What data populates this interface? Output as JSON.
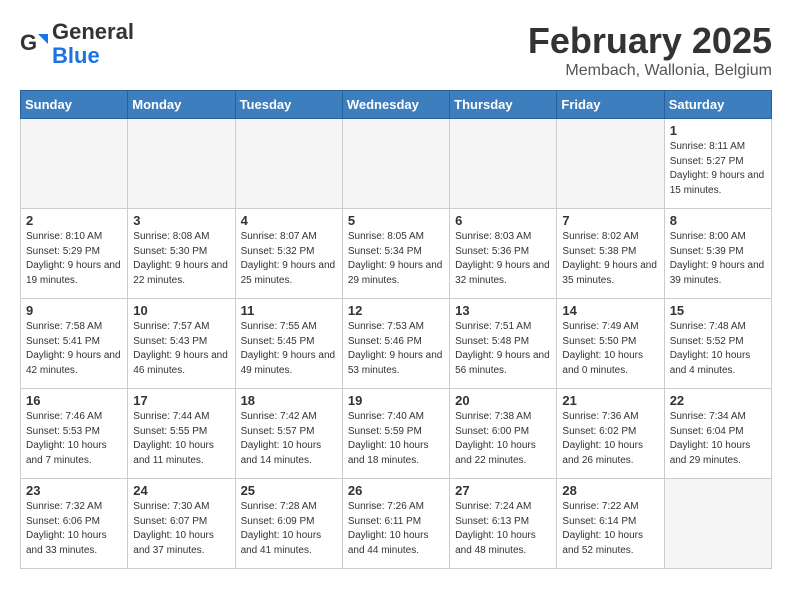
{
  "header": {
    "logo_general": "General",
    "logo_blue": "Blue",
    "month": "February 2025",
    "location": "Membach, Wallonia, Belgium"
  },
  "days_of_week": [
    "Sunday",
    "Monday",
    "Tuesday",
    "Wednesday",
    "Thursday",
    "Friday",
    "Saturday"
  ],
  "weeks": [
    [
      {
        "day": "",
        "info": ""
      },
      {
        "day": "",
        "info": ""
      },
      {
        "day": "",
        "info": ""
      },
      {
        "day": "",
        "info": ""
      },
      {
        "day": "",
        "info": ""
      },
      {
        "day": "",
        "info": ""
      },
      {
        "day": "1",
        "info": "Sunrise: 8:11 AM\nSunset: 5:27 PM\nDaylight: 9 hours and 15 minutes."
      }
    ],
    [
      {
        "day": "2",
        "info": "Sunrise: 8:10 AM\nSunset: 5:29 PM\nDaylight: 9 hours and 19 minutes."
      },
      {
        "day": "3",
        "info": "Sunrise: 8:08 AM\nSunset: 5:30 PM\nDaylight: 9 hours and 22 minutes."
      },
      {
        "day": "4",
        "info": "Sunrise: 8:07 AM\nSunset: 5:32 PM\nDaylight: 9 hours and 25 minutes."
      },
      {
        "day": "5",
        "info": "Sunrise: 8:05 AM\nSunset: 5:34 PM\nDaylight: 9 hours and 29 minutes."
      },
      {
        "day": "6",
        "info": "Sunrise: 8:03 AM\nSunset: 5:36 PM\nDaylight: 9 hours and 32 minutes."
      },
      {
        "day": "7",
        "info": "Sunrise: 8:02 AM\nSunset: 5:38 PM\nDaylight: 9 hours and 35 minutes."
      },
      {
        "day": "8",
        "info": "Sunrise: 8:00 AM\nSunset: 5:39 PM\nDaylight: 9 hours and 39 minutes."
      }
    ],
    [
      {
        "day": "9",
        "info": "Sunrise: 7:58 AM\nSunset: 5:41 PM\nDaylight: 9 hours and 42 minutes."
      },
      {
        "day": "10",
        "info": "Sunrise: 7:57 AM\nSunset: 5:43 PM\nDaylight: 9 hours and 46 minutes."
      },
      {
        "day": "11",
        "info": "Sunrise: 7:55 AM\nSunset: 5:45 PM\nDaylight: 9 hours and 49 minutes."
      },
      {
        "day": "12",
        "info": "Sunrise: 7:53 AM\nSunset: 5:46 PM\nDaylight: 9 hours and 53 minutes."
      },
      {
        "day": "13",
        "info": "Sunrise: 7:51 AM\nSunset: 5:48 PM\nDaylight: 9 hours and 56 minutes."
      },
      {
        "day": "14",
        "info": "Sunrise: 7:49 AM\nSunset: 5:50 PM\nDaylight: 10 hours and 0 minutes."
      },
      {
        "day": "15",
        "info": "Sunrise: 7:48 AM\nSunset: 5:52 PM\nDaylight: 10 hours and 4 minutes."
      }
    ],
    [
      {
        "day": "16",
        "info": "Sunrise: 7:46 AM\nSunset: 5:53 PM\nDaylight: 10 hours and 7 minutes."
      },
      {
        "day": "17",
        "info": "Sunrise: 7:44 AM\nSunset: 5:55 PM\nDaylight: 10 hours and 11 minutes."
      },
      {
        "day": "18",
        "info": "Sunrise: 7:42 AM\nSunset: 5:57 PM\nDaylight: 10 hours and 14 minutes."
      },
      {
        "day": "19",
        "info": "Sunrise: 7:40 AM\nSunset: 5:59 PM\nDaylight: 10 hours and 18 minutes."
      },
      {
        "day": "20",
        "info": "Sunrise: 7:38 AM\nSunset: 6:00 PM\nDaylight: 10 hours and 22 minutes."
      },
      {
        "day": "21",
        "info": "Sunrise: 7:36 AM\nSunset: 6:02 PM\nDaylight: 10 hours and 26 minutes."
      },
      {
        "day": "22",
        "info": "Sunrise: 7:34 AM\nSunset: 6:04 PM\nDaylight: 10 hours and 29 minutes."
      }
    ],
    [
      {
        "day": "23",
        "info": "Sunrise: 7:32 AM\nSunset: 6:06 PM\nDaylight: 10 hours and 33 minutes."
      },
      {
        "day": "24",
        "info": "Sunrise: 7:30 AM\nSunset: 6:07 PM\nDaylight: 10 hours and 37 minutes."
      },
      {
        "day": "25",
        "info": "Sunrise: 7:28 AM\nSunset: 6:09 PM\nDaylight: 10 hours and 41 minutes."
      },
      {
        "day": "26",
        "info": "Sunrise: 7:26 AM\nSunset: 6:11 PM\nDaylight: 10 hours and 44 minutes."
      },
      {
        "day": "27",
        "info": "Sunrise: 7:24 AM\nSunset: 6:13 PM\nDaylight: 10 hours and 48 minutes."
      },
      {
        "day": "28",
        "info": "Sunrise: 7:22 AM\nSunset: 6:14 PM\nDaylight: 10 hours and 52 minutes."
      },
      {
        "day": "",
        "info": ""
      }
    ]
  ]
}
